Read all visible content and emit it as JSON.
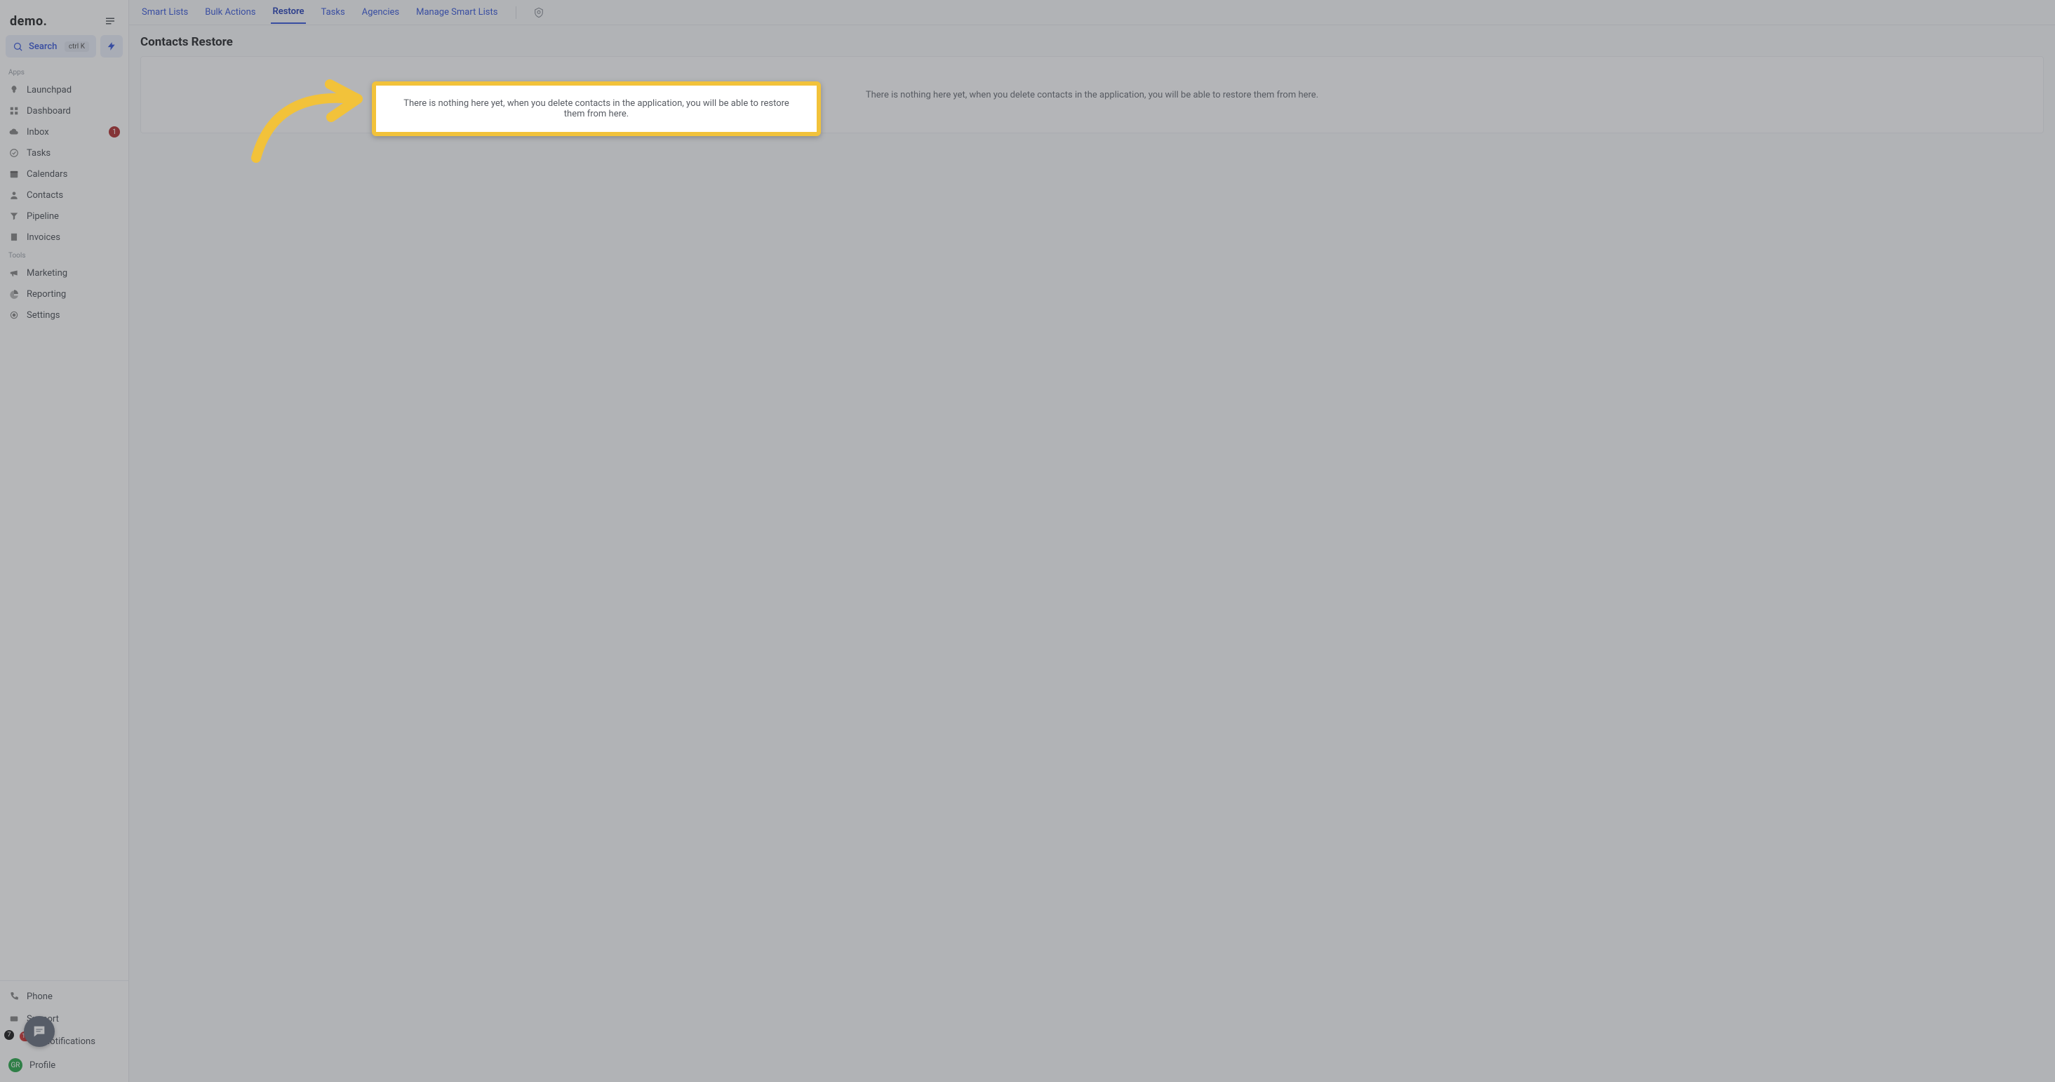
{
  "brand": "demo",
  "search": {
    "label": "Search",
    "shortcut": "ctrl K"
  },
  "sections": {
    "apps_label": "Apps",
    "tools_label": "Tools"
  },
  "nav_apps": [
    {
      "label": "Launchpad",
      "icon": "rocket"
    },
    {
      "label": "Dashboard",
      "icon": "grid"
    },
    {
      "label": "Inbox",
      "icon": "cloud",
      "badge": "1"
    },
    {
      "label": "Tasks",
      "icon": "check"
    },
    {
      "label": "Calendars",
      "icon": "calendar"
    },
    {
      "label": "Contacts",
      "icon": "user"
    },
    {
      "label": "Pipeline",
      "icon": "funnel"
    },
    {
      "label": "Invoices",
      "icon": "receipt"
    }
  ],
  "nav_tools": [
    {
      "label": "Marketing",
      "icon": "megaphone"
    },
    {
      "label": "Reporting",
      "icon": "pie"
    },
    {
      "label": "Settings",
      "icon": "dot"
    }
  ],
  "bottom": {
    "phone": "Phone",
    "support": "Support",
    "notifications": "Notifications",
    "notif_badge_dark": "7",
    "notif_badge_red": "13",
    "profile": "Profile",
    "avatar_initials": "GR"
  },
  "tabs": [
    {
      "label": "Smart Lists"
    },
    {
      "label": "Bulk Actions"
    },
    {
      "label": "Restore",
      "active": true
    },
    {
      "label": "Tasks"
    },
    {
      "label": "Agencies"
    },
    {
      "label": "Manage Smart Lists"
    }
  ],
  "page": {
    "title": "Contacts Restore",
    "empty_message": "There is nothing here yet, when you delete contacts in the application, you will be able to restore them from here."
  }
}
